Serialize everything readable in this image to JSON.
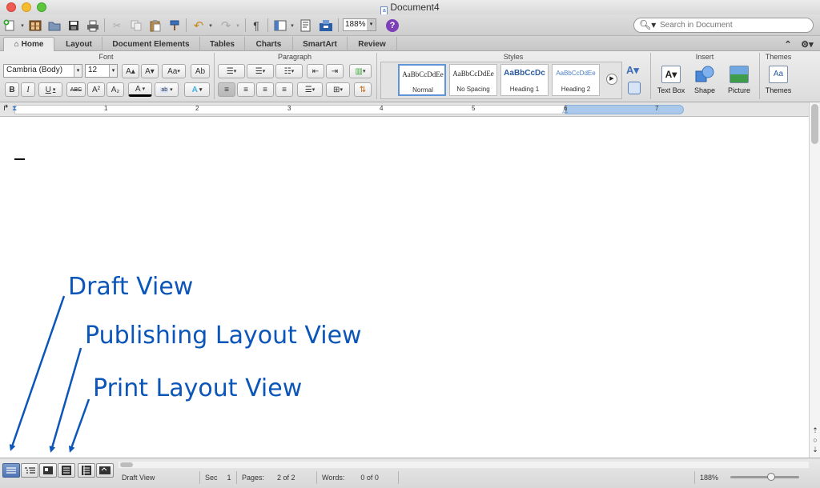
{
  "window": {
    "title": "Document4",
    "traffic_lights": [
      "#ee5b52",
      "#f5bc30",
      "#5fc53f"
    ]
  },
  "toolbar": {
    "zoom": "188%",
    "search_placeholder": "Search in Document",
    "pilcrow": "¶",
    "help": "?"
  },
  "ribbon_tabs": [
    "Home",
    "Layout",
    "Document Elements",
    "Tables",
    "Charts",
    "SmartArt",
    "Review"
  ],
  "ribbon": {
    "groups": {
      "font": "Font",
      "paragraph": "Paragraph",
      "styles": "Styles",
      "insert": "Insert",
      "themes": "Themes"
    },
    "font_name": "Cambria (Body)",
    "font_size": "12",
    "format_buttons": {
      "bold": "B",
      "italic": "I",
      "underline": "U",
      "strike": "ABC",
      "superscript": "A²",
      "subscript": "A₂",
      "font_color": "A",
      "grow": "A▴",
      "shrink": "A▾",
      "case": "Aa",
      "clear": "Ab",
      "text_effects": "A"
    },
    "styles": [
      {
        "preview": "AaBbCcDdEe",
        "name": "Normal"
      },
      {
        "preview": "AaBbCcDdEe",
        "name": "No Spacing"
      },
      {
        "preview": "AaBbCcDc",
        "name": "Heading 1"
      },
      {
        "preview": "AaBbCcDdEe",
        "name": "Heading 2"
      }
    ],
    "insert_items": [
      {
        "label": "Text Box"
      },
      {
        "label": "Shape"
      },
      {
        "label": "Picture"
      }
    ],
    "themes_button": "Themes",
    "themes_icon_text": "Aa"
  },
  "ruler": {
    "numbers": [
      "1",
      "2",
      "3",
      "4",
      "5",
      "6",
      "7"
    ]
  },
  "annotations": {
    "draft": "Draft View",
    "publishing": "Publishing Layout View",
    "print": "Print Layout View",
    "color": "#0b56b8"
  },
  "status": {
    "view_name": "Draft View",
    "sec_label": "Sec",
    "sec_value": "1",
    "pages_label": "Pages:",
    "pages_value": "2 of 2",
    "words_label": "Words:",
    "words_value": "0 of 0",
    "zoom": "188%"
  }
}
